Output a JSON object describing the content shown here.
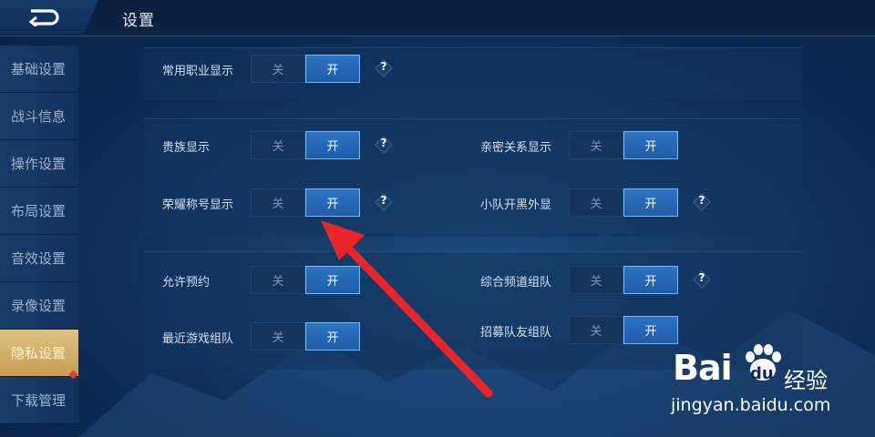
{
  "header": {
    "title": "设置"
  },
  "sidebar": {
    "items": [
      {
        "label": "基础设置"
      },
      {
        "label": "战斗信息"
      },
      {
        "label": "操作设置"
      },
      {
        "label": "布局设置"
      },
      {
        "label": "音效设置"
      },
      {
        "label": "录像设置"
      },
      {
        "label": "隐私设置",
        "active": true
      },
      {
        "label": "下载管理",
        "badge": "red-dot"
      }
    ]
  },
  "toggle_text": {
    "off": "关",
    "on": "开"
  },
  "help_text": "?",
  "settings": {
    "career_display": {
      "label": "常用职业显示",
      "state": "on",
      "has_help": true
    },
    "noble_display": {
      "label": "贵族显示",
      "state": "on",
      "has_help": true
    },
    "intimate_display": {
      "label": "亲密关系显示",
      "state": "on",
      "has_help": false
    },
    "honor_title_display": {
      "label": "荣耀称号显示",
      "state": "on",
      "has_help": true
    },
    "team_blacklist_display": {
      "label": "小队开黑外显",
      "state": "on",
      "has_help": true
    },
    "allow_reservation": {
      "label": "允许预约",
      "state": "on",
      "has_help": false
    },
    "channel_team": {
      "label": "综合频道组队",
      "state": "on",
      "has_help": true
    },
    "recent_game_team": {
      "label": "最近游戏组队",
      "state": "on",
      "has_help": false
    },
    "recruit_teammates": {
      "label": "招募队友组队",
      "state": "on",
      "has_help": false
    }
  },
  "annotation": {
    "color": "#e8262a"
  },
  "watermark": {
    "brand": "Bai",
    "brand_du": "du",
    "product": "经验",
    "url": "jingyan.baidu.com"
  },
  "colors": {
    "active_tab": "#d4ae68",
    "toggle_on": "#2a6fbe",
    "arrow": "#e8262a"
  }
}
